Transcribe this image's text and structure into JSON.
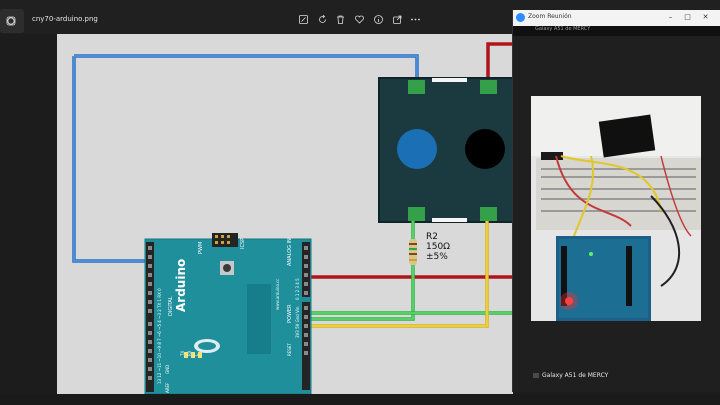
{
  "photos_app": {
    "file_name": "cny70-arduino.png",
    "toolbar": {
      "edit_icon": "edit-image-icon",
      "rotate_icon": "rotate-icon",
      "delete_icon": "trash-icon",
      "favorite_icon": "heart-icon",
      "info_icon": "info-icon",
      "share_icon": "share-icon",
      "more_icon": "more-icon"
    }
  },
  "circuit": {
    "resistor_name": "R2",
    "resistor_value": "150Ω",
    "resistor_tolerance": "±5%",
    "board_name": "Arduino",
    "board_url": "www.arduino.cc",
    "label_icsp": "ICSP",
    "label_pwm": "PWM",
    "label_digital": "DIGITAL",
    "label_analog_in": "ANALOG IN",
    "label_power": "POWER",
    "label_aref": "AREF",
    "label_gnd": "GND",
    "label_tx": "TX",
    "label_rx": "RX",
    "label_l": "L",
    "label_reset": "RESET",
    "power_pins": "3V3 5V Gnd Vin",
    "digital_pins": "13 12 ~11 ~10 ~9 8 7 ~6 ~5 4 ~3 2 TX 1 RX 0",
    "analog_pins": "0 1 2 3 4 5",
    "colors": {
      "wire_blue": "#3b82d6",
      "wire_red": "#c0161b",
      "wire_green": "#39d04f",
      "wire_yellow": "#f0d22c",
      "board": "#1f8f9c",
      "sensor": "#1a3a3f"
    }
  },
  "zoom": {
    "window_title": "Zoom Reunión",
    "top_text": "Galaxy A51 de MERCY",
    "participant_name": "Galaxy A51 de MERCY"
  }
}
